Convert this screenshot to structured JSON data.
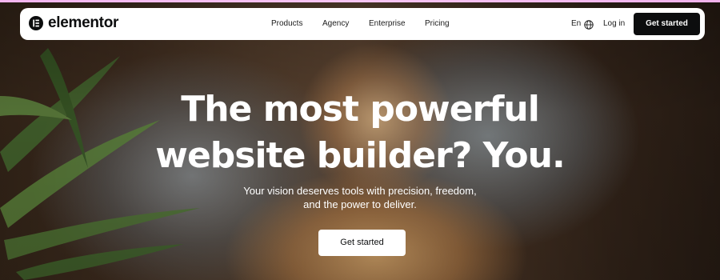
{
  "brand": {
    "name": "elementor",
    "icon": "elementor-logo-icon"
  },
  "nav": {
    "items": [
      {
        "label": "Products"
      },
      {
        "label": "Agency"
      },
      {
        "label": "Enterprise"
      },
      {
        "label": "Pricing"
      }
    ],
    "language": "En",
    "language_icon": "globe-icon",
    "login_label": "Log in",
    "cta_label": "Get started"
  },
  "hero": {
    "title_line1": "The most powerful",
    "title_line2": "website builder? You.",
    "subtitle_line1": "Your vision deserves tools with precision, freedom,",
    "subtitle_line2": "and the power to deliver.",
    "cta_label": "Get started"
  },
  "colors": {
    "accent_strip": "#f3b5ef",
    "primary_dark": "#0c0d0e",
    "white": "#ffffff"
  }
}
